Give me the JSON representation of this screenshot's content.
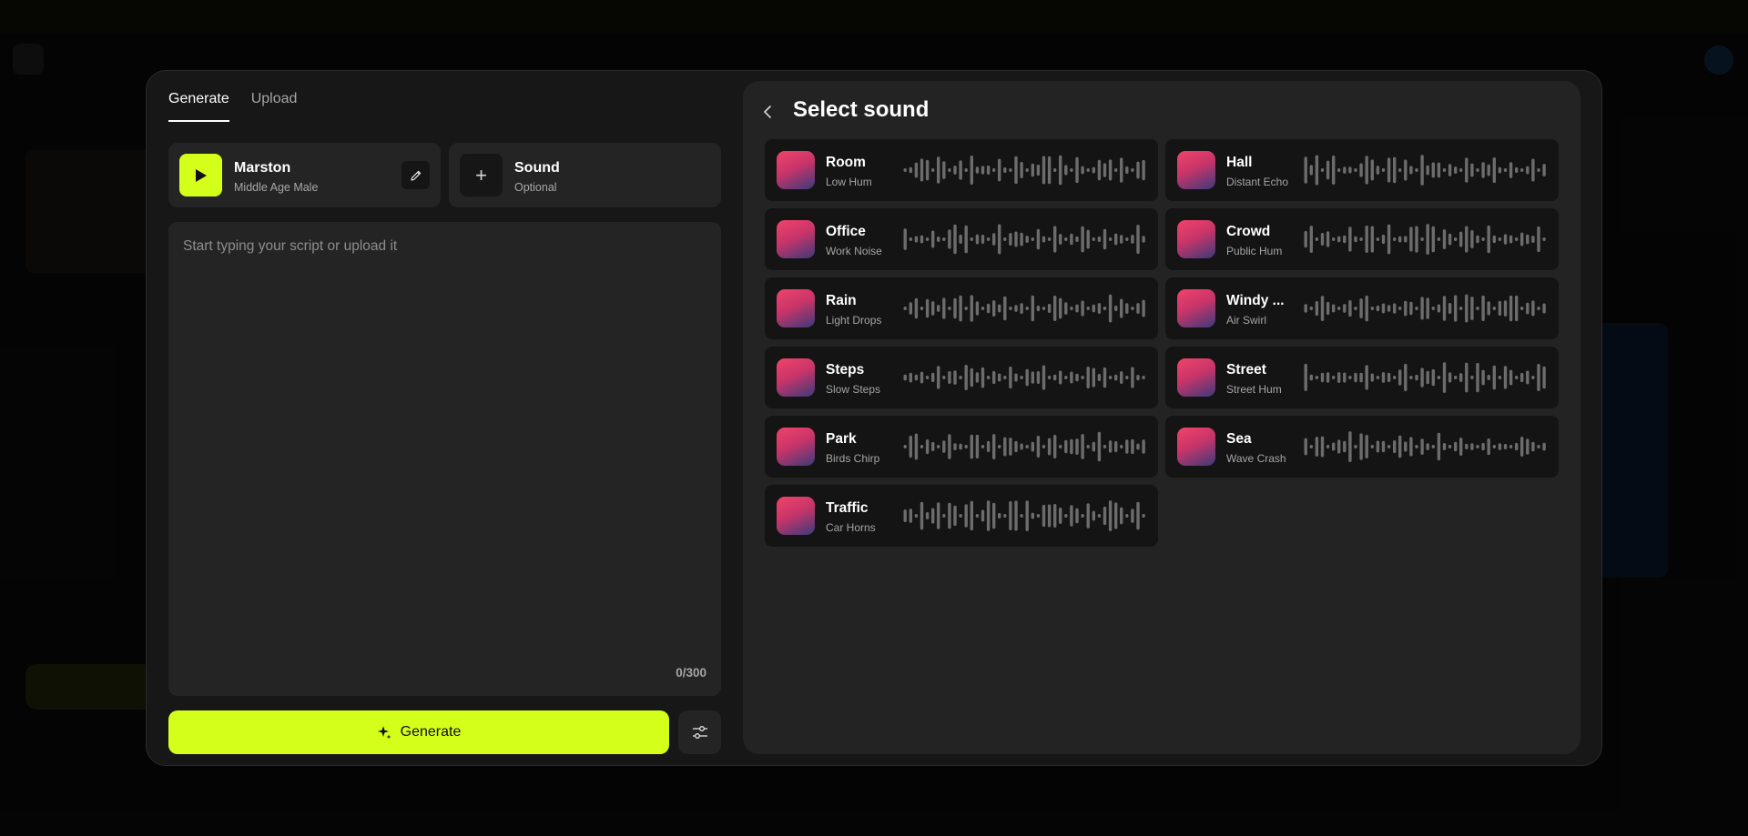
{
  "colors": {
    "accent": "#d4ff1b",
    "modal_bg": "#171717",
    "panel_bg": "#232323",
    "card_bg": "#242424",
    "item_bg": "#141414"
  },
  "tabs": [
    {
      "label": "Generate",
      "active": true
    },
    {
      "label": "Upload",
      "active": false
    }
  ],
  "voice": {
    "name": "Marston",
    "description": "Middle Age Male",
    "play_icon": "play-icon",
    "edit_icon": "pencil-icon"
  },
  "sound_slot": {
    "title": "Sound",
    "subtitle": "Optional",
    "icon": "plus-icon"
  },
  "script": {
    "placeholder": "Start typing your script or upload it",
    "char_count": "0/300"
  },
  "generate_button": {
    "label": "Generate",
    "icon": "sparkle-icon"
  },
  "settings_button": {
    "icon": "sliders-icon"
  },
  "panel": {
    "title": "Select sound",
    "back_icon": "chevron-left-icon",
    "sounds": [
      {
        "name": "Room",
        "desc": "Low Hum"
      },
      {
        "name": "Hall",
        "desc": "Distant Echo"
      },
      {
        "name": "Office",
        "desc": "Work Noise"
      },
      {
        "name": "Crowd",
        "desc": "Public Hum"
      },
      {
        "name": "Rain",
        "desc": "Light Drops"
      },
      {
        "name": "Windy ...",
        "desc": "Air Swirl"
      },
      {
        "name": "Steps",
        "desc": "Slow Steps"
      },
      {
        "name": "Street",
        "desc": "Street Hum"
      },
      {
        "name": "Park",
        "desc": "Birds Chirp"
      },
      {
        "name": "Sea",
        "desc": "Wave Crash"
      },
      {
        "name": "Traffic",
        "desc": "Car Horns"
      }
    ]
  }
}
